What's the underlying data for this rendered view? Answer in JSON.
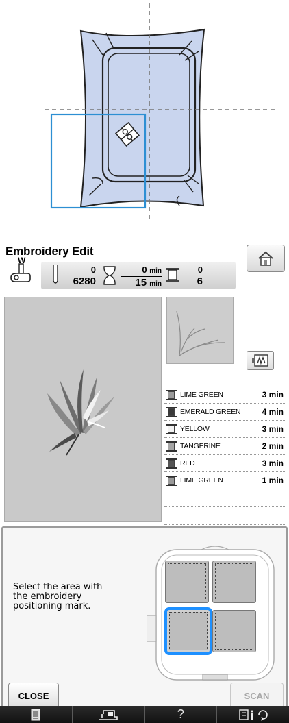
{
  "screen": {
    "title": "Embroidery Edit",
    "foot_label": "W",
    "stitch_count": {
      "current": "0",
      "total": "6280"
    },
    "time": {
      "elapsed": "0",
      "total": "15",
      "unit": "min"
    },
    "thread_changes": {
      "current": "0",
      "total": "6"
    },
    "colors": [
      {
        "name": "LIME GREEN",
        "time": "3 min",
        "swatch": "#9a9a9a"
      },
      {
        "name": "EMERALD GREEN",
        "time": "4 min",
        "swatch": "#3a3a3a"
      },
      {
        "name": "YELLOW",
        "time": "3 min",
        "swatch": "#f2f2f2"
      },
      {
        "name": "TANGERINE",
        "time": "2 min",
        "swatch": "#a6a6a6"
      },
      {
        "name": "RED",
        "time": "3 min",
        "swatch": "#555555"
      },
      {
        "name": "LIME GREEN",
        "time": "1 min",
        "swatch": "#9a9a9a"
      }
    ],
    "dialog": {
      "message": [
        "Select the area with",
        "the embroidery",
        "positioning mark."
      ],
      "close_label": "CLOSE",
      "scan_label": "SCAN"
    },
    "bottom_bar": {
      "help_label": "?"
    }
  },
  "colors": {
    "hoop_fabric": "#c9d5ee",
    "selection": "#2d8fd3",
    "highlight": "#1e90ff"
  }
}
